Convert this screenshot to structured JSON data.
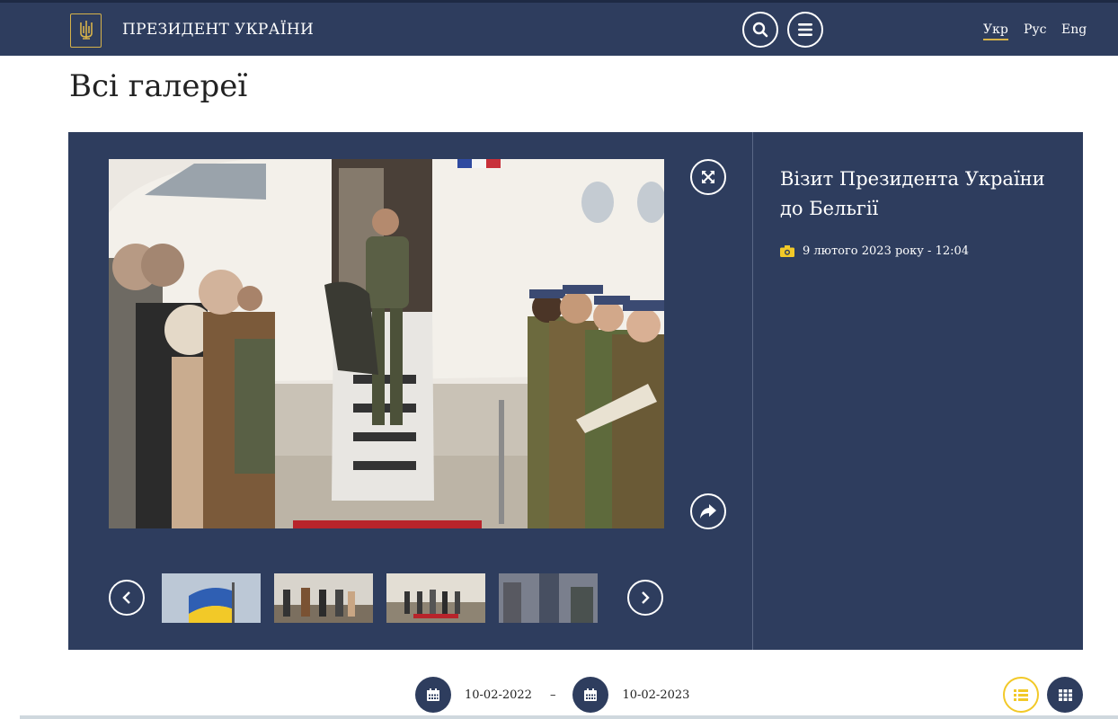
{
  "header": {
    "brand": "ПРЕЗИДЕНТ УКРАЇНИ",
    "search_icon": "search-icon",
    "menu_icon": "menu-icon",
    "languages": [
      {
        "label": "Укр",
        "active": true
      },
      {
        "label": "Рус",
        "active": false
      },
      {
        "label": "Eng",
        "active": false
      }
    ]
  },
  "page": {
    "title": "Всі галереї"
  },
  "gallery": {
    "title": "Візит Президента України до Бельгії",
    "date": "9 лютого 2023 року - 12:04",
    "icons": {
      "fullscreen": "expand-icon",
      "share": "share-icon",
      "prev": "chevron-left-icon",
      "next": "chevron-right-icon",
      "date": "camera-icon"
    }
  },
  "filter": {
    "from": "10-02-2022",
    "separator": "–",
    "to": "10-02-2023"
  },
  "colors": {
    "navy": "#2e3d5e",
    "gold": "#d6b24a",
    "white": "#ffffff"
  }
}
